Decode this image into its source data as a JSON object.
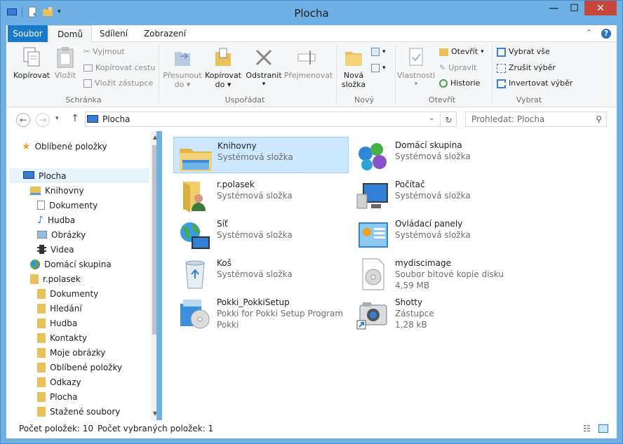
{
  "window": {
    "title": "Plocha"
  },
  "ribbon_tabs": {
    "file": "Soubor",
    "home": "Domů",
    "share": "Sdílení",
    "view": "Zobrazení"
  },
  "clipboard": {
    "copy": "Kopírovat",
    "paste": "Vložit",
    "cut": "Vyjmout",
    "copy_path": "Kopírovat cestu",
    "paste_shortcut": "Vložit zástupce",
    "group_label": "Schránka"
  },
  "organize": {
    "move_to_1": "Přesunout",
    "move_to_2": "do",
    "copy_to_1": "Kopírovat",
    "copy_to_2": "do",
    "delete": "Odstranit",
    "rename": "Přejmenovat",
    "group_label": "Uspořádat"
  },
  "new": {
    "new_folder_1": "Nová",
    "new_folder_2": "složka",
    "group_label": "Nový"
  },
  "open": {
    "properties": "Vlastnosti",
    "open": "Otevřít",
    "edit": "Upravit",
    "history": "Historie",
    "group_label": "Otevřít"
  },
  "select": {
    "select_all": "Vybrat vše",
    "select_none": "Zrušit výběr",
    "invert": "Invertovat výběr",
    "group_label": "Vybrat"
  },
  "address": {
    "path": "Plocha",
    "search_placeholder": "Prohledat: Plocha"
  },
  "nav_pane": {
    "favorites": "Oblíbené položky",
    "desktop": "Plocha",
    "libraries": "Knihovny",
    "documents": "Dokumenty",
    "music": "Hudba",
    "pictures": "Obrázky",
    "videos": "Videa",
    "homegroup": "Domácí skupina",
    "user": "r.polasek",
    "user_items": [
      "Dokumenty",
      "Hledání",
      "Hudba",
      "Kontakty",
      "Moje obrázky",
      "Oblíbené položky",
      "Odkazy",
      "Plocha",
      "Stažené soubory"
    ]
  },
  "items": [
    {
      "name": "Knihovny",
      "line2": "Systémová složka",
      "line3": "",
      "icon": "libraries-folder-icon"
    },
    {
      "name": "Domácí skupina",
      "line2": "Systémová složka",
      "line3": "",
      "icon": "homegroup-icon"
    },
    {
      "name": "r.polasek",
      "line2": "Systémová složka",
      "line3": "",
      "icon": "user-folder-icon"
    },
    {
      "name": "Počítač",
      "line2": "Systémová složka",
      "line3": "",
      "icon": "computer-icon"
    },
    {
      "name": "Síť",
      "line2": "Systémová složka",
      "line3": "",
      "icon": "network-icon"
    },
    {
      "name": "Ovládací panely",
      "line2": "Systémová složka",
      "line3": "",
      "icon": "control-panel-icon"
    },
    {
      "name": "Koš",
      "line2": "Systémová složka",
      "line3": "",
      "icon": "recycle-bin-icon"
    },
    {
      "name": "mydiscimage",
      "line2": "Soubor bitové kopie disku",
      "line3": "4,59 MB",
      "icon": "disc-image-icon"
    },
    {
      "name": "Pokki_PokkiSetup",
      "line2": "Pokki for Pokki Setup Program",
      "line3": "Pokki",
      "icon": "installer-icon"
    },
    {
      "name": "Shotty",
      "line2": "Zástupce",
      "line3": "1,28 kB",
      "icon": "camera-shortcut-icon"
    }
  ],
  "status": {
    "count": "Počet položek: 10",
    "selected": "Počet vybraných položek: 1"
  },
  "colors": {
    "title_bar": "#6fb0e4",
    "file_tab": "#1979ca",
    "close": "#c7463b",
    "selection": "#cce8ff"
  }
}
